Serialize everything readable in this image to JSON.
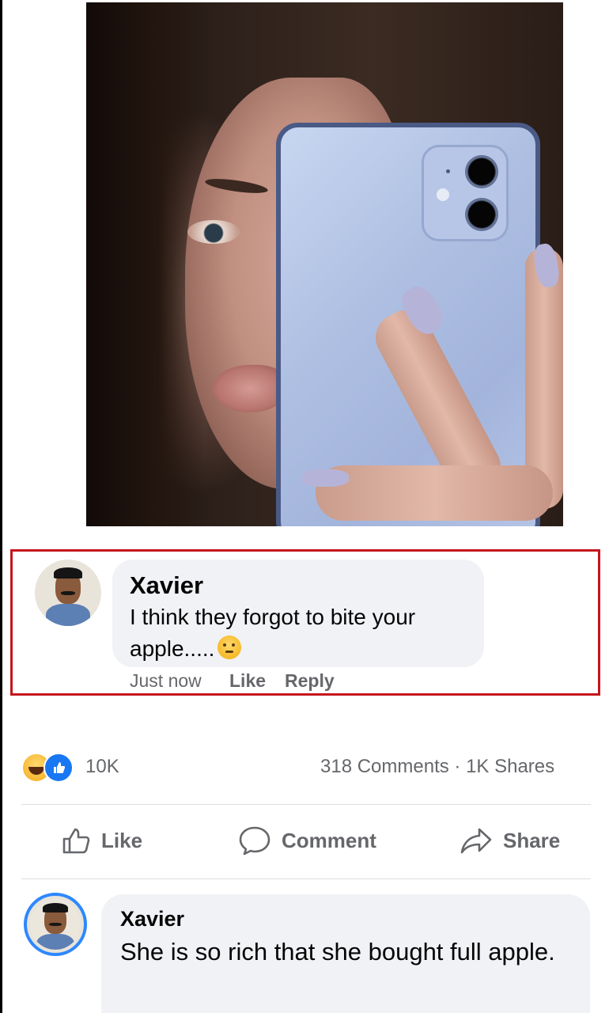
{
  "post_image": {
    "description_icon": "mirror-selfie-photo"
  },
  "highlighted_comment": {
    "author": "Xavier",
    "text": "I think they forgot to bite your apple.....",
    "emoji": "thinking-emoji",
    "time": "Just now",
    "like_label": "Like",
    "reply_label": "Reply",
    "highlight_color": "#c4161c"
  },
  "reactions": {
    "icons": [
      "haha-icon",
      "like-icon"
    ],
    "count": "10K",
    "stats": "318 Comments · 1K Shares"
  },
  "actions": {
    "like": "Like",
    "comment": "Comment",
    "share": "Share"
  },
  "bottom_comment": {
    "author": "Xavier",
    "text": "She is so rich that she bought full apple."
  },
  "colors": {
    "bubble": "#f0f2f5",
    "meta_text": "#65676b",
    "like_blue": "#1877f2"
  }
}
